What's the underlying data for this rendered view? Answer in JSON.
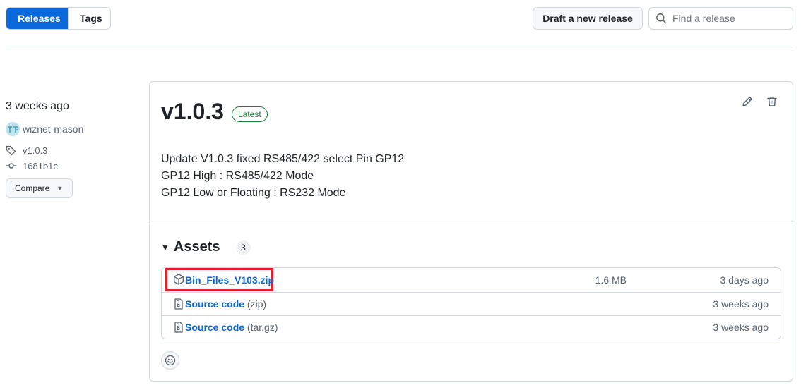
{
  "tabs": {
    "releases": "Releases",
    "tags": "Tags"
  },
  "toolbar": {
    "draft_label": "Draft a new release",
    "search_placeholder": "Find a release"
  },
  "meta": {
    "date": "3 weeks ago",
    "author": "wiznet-mason",
    "tag": "v1.0.3",
    "commit": "1681b1c",
    "compare_label": "Compare"
  },
  "release": {
    "title": "v1.0.3",
    "badge": "Latest",
    "notes": [
      "Update V1.0.3 fixed RS485/422 select Pin GP12",
      "GP12 High : RS485/422 Mode",
      "GP12 Low or Floating : RS232 Mode"
    ]
  },
  "assets": {
    "label": "Assets",
    "count": "3",
    "items": [
      {
        "name": "Bin_Files_V103.zip",
        "suffix": "",
        "size": "1.6 MB",
        "date": "3 days ago",
        "icon": "package-icon"
      },
      {
        "name": "Source code",
        "suffix": "(zip)",
        "size": "",
        "date": "3 weeks ago",
        "icon": "file-zip-icon"
      },
      {
        "name": "Source code",
        "suffix": "(tar.gz)",
        "size": "",
        "date": "3 weeks ago",
        "icon": "file-zip-icon"
      }
    ]
  },
  "colors": {
    "accent": "#0969da",
    "latest": "#1a7f37",
    "highlight": "#e0202c",
    "border": "#d0d7de"
  }
}
